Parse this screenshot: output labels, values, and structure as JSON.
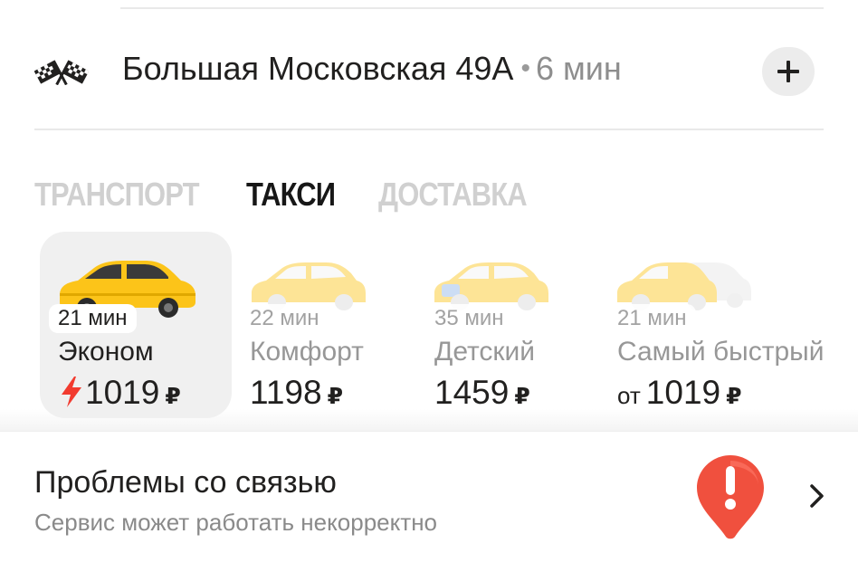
{
  "destination": {
    "address": "Большая Московская 49А",
    "separator": "•",
    "eta": "6 мин",
    "flag_icon": "checkered-flags-icon",
    "add_icon": "plus-icon"
  },
  "tabs": [
    {
      "label": "ТРАНСПОРТ",
      "active": false
    },
    {
      "label": "ТАКСИ",
      "active": true
    },
    {
      "label": "ДОСТАВКА",
      "active": false
    }
  ],
  "tariffs": [
    {
      "eta": "21 мин",
      "name": "Эконом",
      "price_prefix": "",
      "price": "1019",
      "currency": "₽",
      "selected": true,
      "surge_icon": "lightning-icon"
    },
    {
      "eta": "22 мин",
      "name": "Комфорт",
      "price_prefix": "",
      "price": "1198",
      "currency": "₽",
      "selected": false
    },
    {
      "eta": "35 мин",
      "name": "Детский",
      "price_prefix": "",
      "price": "1459",
      "currency": "₽",
      "selected": false
    },
    {
      "eta": "21 мин",
      "name": "Самый быстрый",
      "price_prefix": "от",
      "price": "1019",
      "currency": "₽",
      "selected": false
    }
  ],
  "alert": {
    "title": "Проблемы со связью",
    "subtitle": "Сервис может работать некорректно",
    "icon": "warning-pin-icon",
    "action_icon": "chevron-right-icon"
  },
  "colors": {
    "car_yellow": "#fcc419",
    "alert_red": "#f0503e",
    "surge_red": "#f23b2f",
    "text_primary": "#21201f",
    "text_muted": "#979797"
  }
}
